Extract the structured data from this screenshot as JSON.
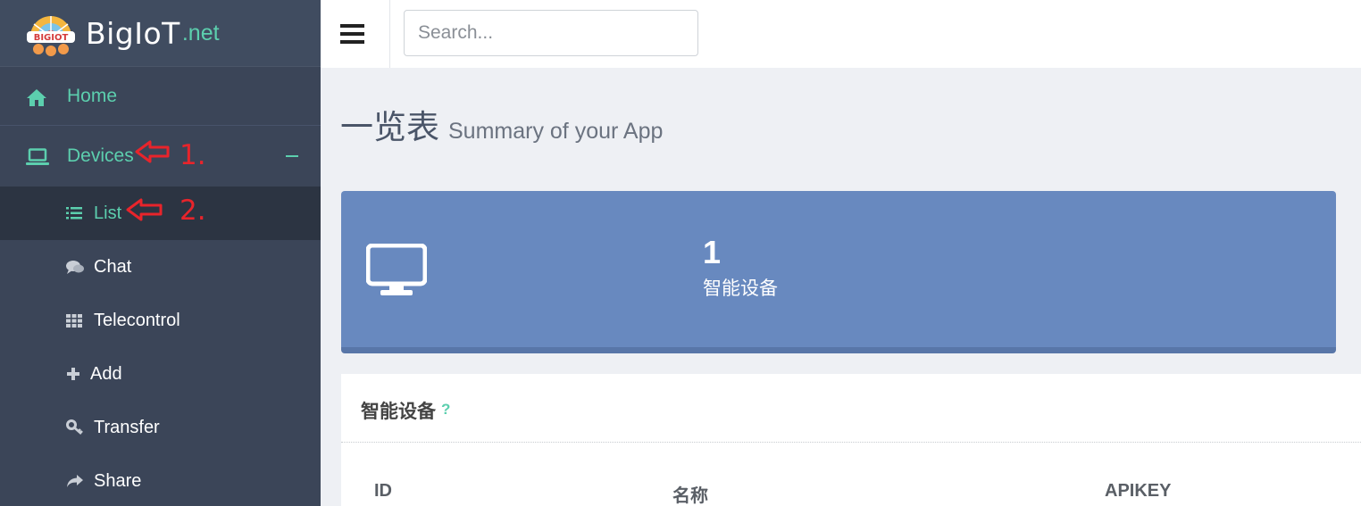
{
  "brand": {
    "name": "BigIoT",
    "tld": ".net",
    "logo_text": "BIGIOT"
  },
  "sidebar": {
    "home_label": "Home",
    "devices_label": "Devices",
    "collapse_symbol": "−",
    "subitems": [
      {
        "label": "List",
        "icon": "list-icon"
      },
      {
        "label": "Chat",
        "icon": "chat-bubbles-icon"
      },
      {
        "label": "Telecontrol",
        "icon": "grid-icon"
      },
      {
        "label": "Add",
        "icon": "plus-icon"
      },
      {
        "label": "Transfer",
        "icon": "key-icon"
      },
      {
        "label": "Share",
        "icon": "share-arrow-icon"
      }
    ]
  },
  "annotations": [
    {
      "label": "1.",
      "color": "#e8242b"
    },
    {
      "label": "2.",
      "color": "#e8242b"
    }
  ],
  "topbar": {
    "search_placeholder": "Search..."
  },
  "page": {
    "title": "一览表",
    "subtitle": "Summary of your App"
  },
  "stat_card": {
    "value": "1",
    "label": "智能设备",
    "icon": "monitor-icon",
    "color": "#6889bf"
  },
  "panel": {
    "title": "智能设备",
    "help": "?",
    "columns": [
      "ID",
      "名称",
      "APIKEY"
    ]
  },
  "colors": {
    "accent": "#5ccfae",
    "sidebar": "#3b4558",
    "annotation": "#e8242b"
  }
}
